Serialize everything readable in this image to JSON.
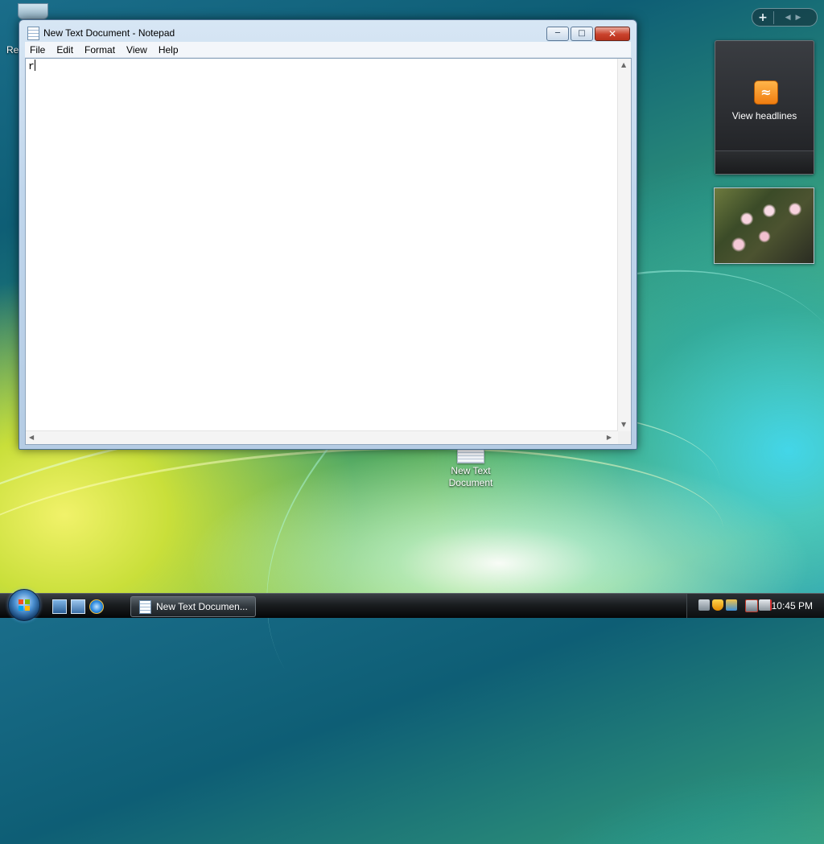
{
  "desktop": {
    "recycle_bin_label": "Re",
    "file_icon_label_line1": "New Text",
    "file_icon_label_line2": "Document"
  },
  "notepad": {
    "title": "New Text Document - Notepad",
    "menu": [
      "File",
      "Edit",
      "Format",
      "View",
      "Help"
    ],
    "content": "r",
    "controls": {
      "minimize": "minimize-icon",
      "maximize": "maximize-icon",
      "close": "close-icon"
    }
  },
  "sidebar": {
    "add_gadget": "+",
    "feed_headlines_label": "View headlines"
  },
  "taskbar": {
    "active_window_label": "New Text Documen...",
    "clock": "10:45 PM"
  },
  "colors": {
    "close_button": "#c9412b",
    "rss_orange": "#f07d10",
    "taskbar_dark": "#1a1d20"
  }
}
